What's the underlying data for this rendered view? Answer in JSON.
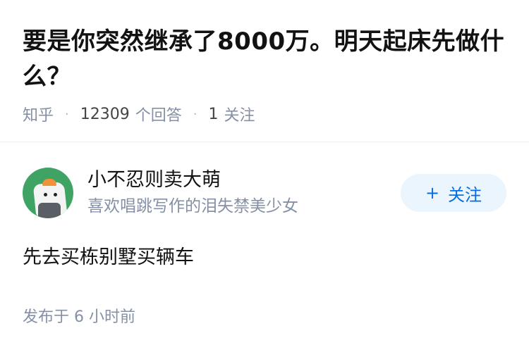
{
  "question": {
    "title": "要是你突然继承了8000万。明天起床先做什么？",
    "source": "知乎",
    "answer_count": "12309",
    "answer_label": "个回答",
    "follower_count": "1",
    "follower_label": "关注",
    "separator": "·"
  },
  "answer": {
    "author_name": "小不忍则卖大萌",
    "author_bio": "喜欢唱跳写作的泪失禁美少女",
    "follow_label": "关注",
    "follow_plus": "+",
    "content": "先去买栋别墅买辆车",
    "time": "发布于 6 小时前"
  },
  "colors": {
    "accent": "#056de8",
    "button_bg": "#ebf5fd",
    "muted_text": "#8590a6",
    "avatar_bg": "#3fa364"
  }
}
